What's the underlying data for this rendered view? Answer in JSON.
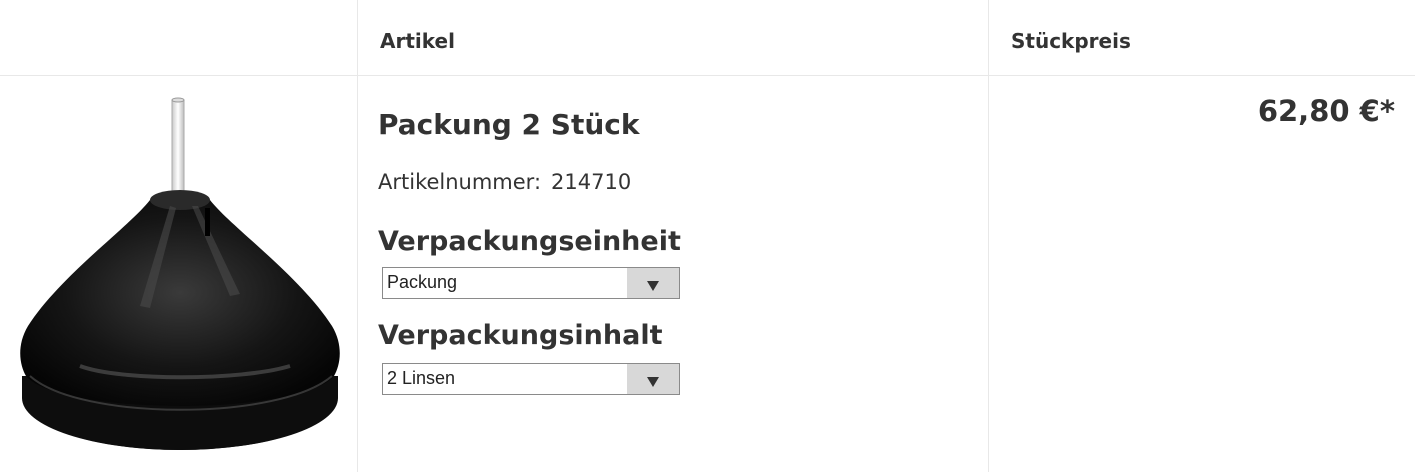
{
  "header": {
    "col_article": "Artikel",
    "col_unit_price": "Stückpreis"
  },
  "product": {
    "image_icon": "product-image-lens-cone",
    "name": "Packung 2 Stück",
    "sku_label": "Artikelnummer:",
    "sku_value": "214710",
    "price": "62,80 €*"
  },
  "options": {
    "packaging_unit": {
      "label": "Verpackungseinheit",
      "selected": "Packung"
    },
    "packaging_content": {
      "label": "Verpackungsinhalt",
      "selected": "2 Linsen"
    }
  },
  "colors": {
    "text": "#333333",
    "border": "#e8e8e8",
    "select_button": "#d8d8d8"
  }
}
